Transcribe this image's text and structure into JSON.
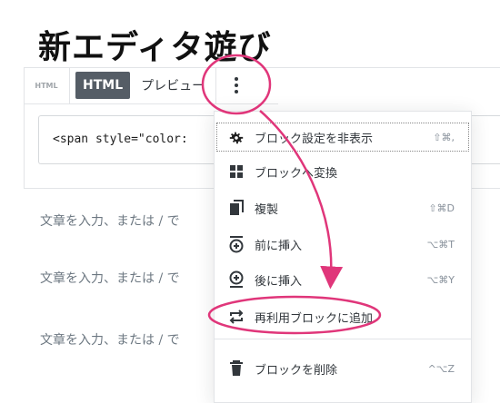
{
  "page": {
    "title": "新エディタ遊び"
  },
  "toolbar": {
    "block_type_label": "HTML",
    "html_tab": "HTML",
    "preview_tab": "プレビュー",
    "more_icon": "vertical-ellipsis"
  },
  "code": {
    "text": "<span style=\"color:"
  },
  "paragraphs": [
    "文章を入力、または / で",
    "文章を入力、または / で",
    "文章を入力、または / で"
  ],
  "menu": {
    "items": [
      {
        "label": "ブロック設定を非表示",
        "shortcut": "⇧⌘,",
        "icon": "gear"
      },
      {
        "label": "ブロックへ変換",
        "shortcut": "",
        "icon": "grid"
      },
      {
        "label": "複製",
        "shortcut": "⇧⌘D",
        "icon": "duplicate"
      },
      {
        "label": "前に挿入",
        "shortcut": "⌥⌘T",
        "icon": "insert-before"
      },
      {
        "label": "後に挿入",
        "shortcut": "⌥⌘Y",
        "icon": "insert-after"
      },
      {
        "label": "再利用ブロックに追加",
        "shortcut": "",
        "icon": "reusable"
      },
      {
        "label": "ブロックを削除",
        "shortcut": "^⌥Z",
        "icon": "trash"
      }
    ]
  },
  "colors": {
    "annotation": "#e0367a",
    "html_tab_bg": "#555d66"
  }
}
